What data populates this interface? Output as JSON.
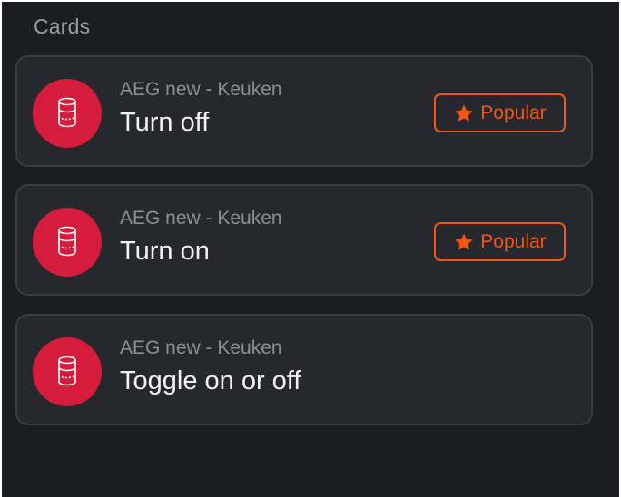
{
  "section": {
    "title": "Cards"
  },
  "colors": {
    "background": "#1c1d21",
    "card_background": "#27282d",
    "card_border": "#3b3c42",
    "icon_circle": "#d61c3c",
    "badge_accent": "#ef5718"
  },
  "cards": [
    {
      "icon": "device-cylinder-icon",
      "subtitle": "AEG new - Keuken",
      "title": "Turn off",
      "badge": {
        "icon": "star-icon",
        "label": "Popular"
      }
    },
    {
      "icon": "device-cylinder-icon",
      "subtitle": "AEG new - Keuken",
      "title": "Turn on",
      "badge": {
        "icon": "star-icon",
        "label": "Popular"
      }
    },
    {
      "icon": "device-cylinder-icon",
      "subtitle": "AEG new - Keuken",
      "title": "Toggle on or off"
    }
  ]
}
